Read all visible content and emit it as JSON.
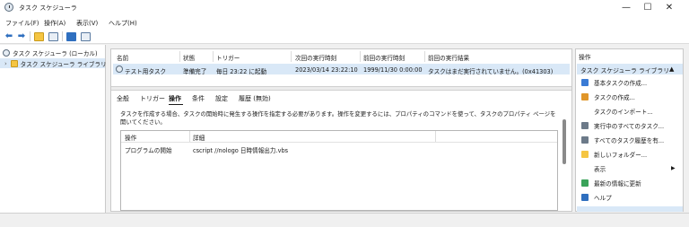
{
  "window": {
    "title": "タスク スケジューラ",
    "controls": {
      "minimize": "—",
      "maximize": "☐",
      "close": "✕"
    }
  },
  "menu": [
    "ファイル(F)",
    "操作(A)",
    "表示(V)",
    "ヘルプ(H)"
  ],
  "toolbar": {
    "icons": [
      "back-arrow-icon",
      "forward-arrow-icon",
      "folder-up-icon",
      "console-tree-icon",
      "help-icon",
      "panel-icon"
    ],
    "back": "⬅",
    "forward": "➡"
  },
  "tree": {
    "root": "タスク スケジューラ (ローカル)",
    "child": "タスク スケジューラ ライブラリ",
    "expander": "›"
  },
  "tasklist": {
    "columns": [
      "名前",
      "状態",
      "トリガー",
      "次回の実行時刻",
      "前回の実行時刻",
      "前回の実行結果"
    ],
    "row": {
      "name": "テスト用タスク",
      "status": "準備完了",
      "trigger": "毎日 23:22 に起動",
      "next_run": "2023/03/14 23:22:10",
      "last_run": "1999/11/30 0:00:00",
      "last_result": "タスクはまだ実行されていません。(0x41303)"
    }
  },
  "details": {
    "tabs": [
      "全般",
      "トリガー",
      "操作",
      "条件",
      "設定",
      "履歴 (無効)"
    ],
    "active_tab": "操作",
    "description": "タスクを作成する場合、タスクの開始時に発生する操作を指定する必要があります。操作を変更するには、プロパティのコマンドを使って、タスクのプロパティ ページを開いてください。",
    "grid_columns": [
      "操作",
      "詳細"
    ],
    "grid_rows": [
      {
        "action": "プログラムの開始",
        "detail": "cscript //nologo 日時情報出力.vbs"
      }
    ]
  },
  "actions": {
    "title": "操作",
    "section": "タスク スケジューラ ライブラリ",
    "section_toggle": "▲",
    "items": [
      {
        "label": "基本タスクの作成...",
        "icon": "basic-task-icon",
        "color": "#3a7bd5"
      },
      {
        "label": "タスクの作成...",
        "icon": "create-task-icon",
        "color": "#e0962a"
      },
      {
        "label": "タスクのインポート...",
        "icon": "none",
        "color": ""
      },
      {
        "label": "実行中のすべてのタスク...",
        "icon": "running-tasks-icon",
        "color": "#6c7a89"
      },
      {
        "label": "すべてのタスク履歴を有...",
        "icon": "history-icon",
        "color": "#6c7a89"
      },
      {
        "label": "新しいフォルダー...",
        "icon": "new-folder-icon",
        "color": "#f5c542"
      },
      {
        "label": "表示",
        "icon": "none",
        "color": "",
        "submenu": "▶"
      },
      {
        "label": "最新の情報に更新",
        "icon": "refresh-icon",
        "color": "#3aa35a"
      },
      {
        "label": "ヘルプ",
        "icon": "help-icon",
        "color": "#2f6fbf"
      }
    ]
  },
  "colors": {
    "selection": "#d9e8f7",
    "accent": "#2f6fbf"
  }
}
